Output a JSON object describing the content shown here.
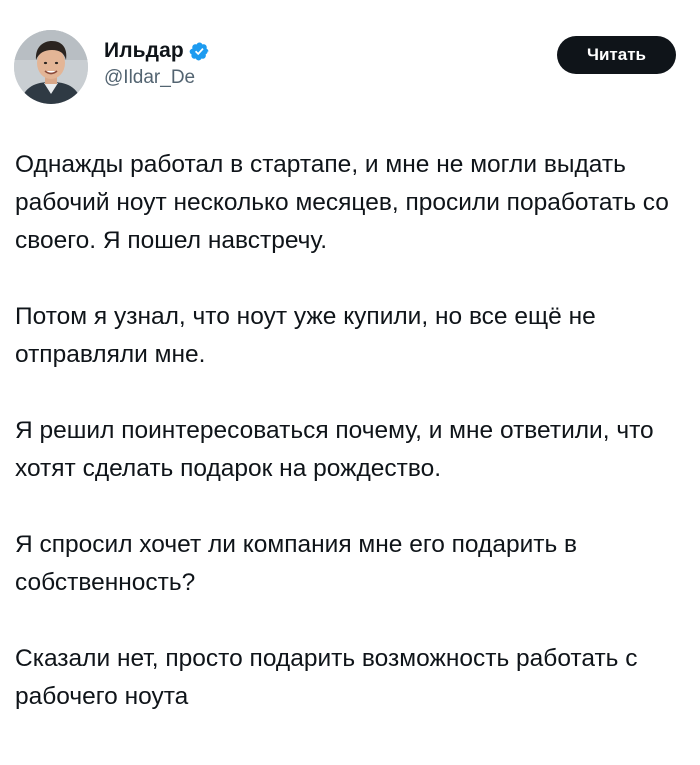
{
  "author": {
    "display_name": "Ильдар",
    "handle": "@Ildar_De",
    "verified_color": "#1d9bf0",
    "avatar_icon": "user-avatar-photo",
    "verified_icon": "verified-badge-icon"
  },
  "actions": {
    "read_label": "Читать"
  },
  "tweet": {
    "paragraphs": [
      "Однажды работал в стартапе, и мне не могли выдать рабочий ноут несколько месяцев, просили поработать со своего. Я пошел навстречу.",
      "Потом я узнал, что ноут уже купили, но все ещё не отправляли мне.",
      "Я решил поинтересоваться почему, и мне ответили, что хотят сделать подарок на рождество.",
      "Я спросил хочет ли компания мне его подарить в собственность?",
      "Сказали нет, просто подарить возможность работать с рабочего ноута"
    ]
  }
}
